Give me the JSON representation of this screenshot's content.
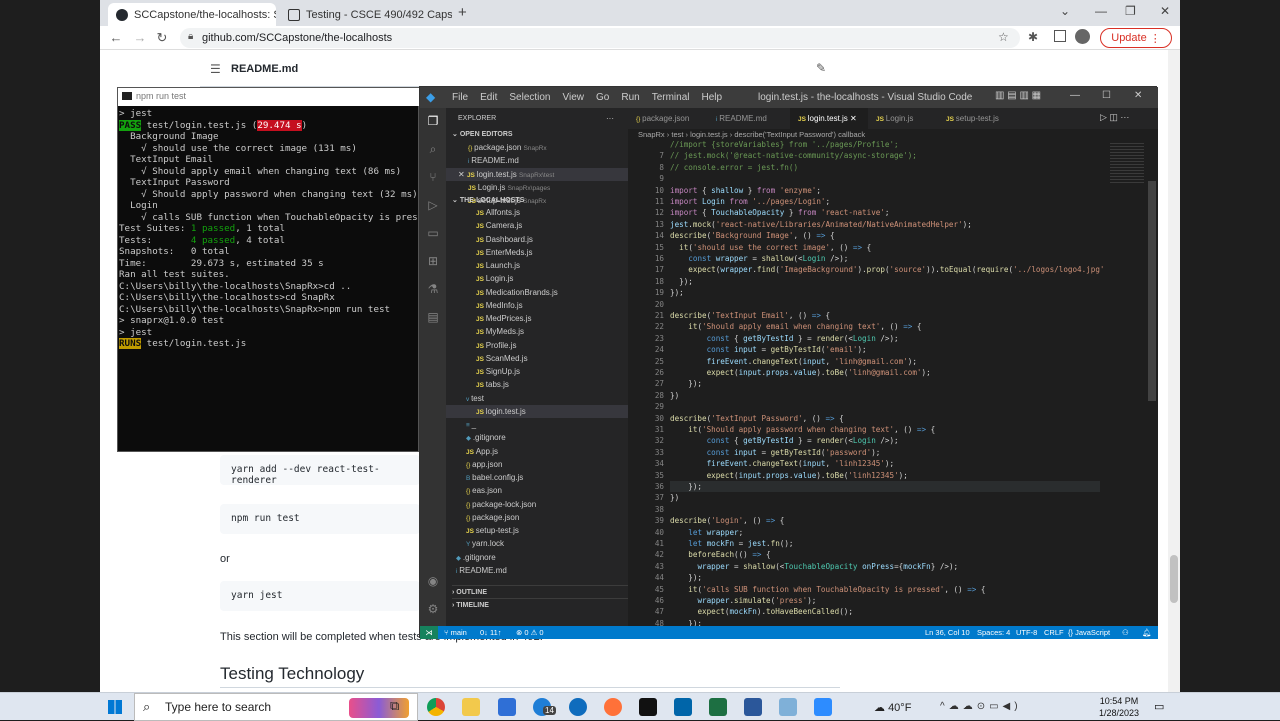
{
  "browser": {
    "tabs": [
      {
        "title": "SCCapstone/the-localhosts: Snap"
      },
      {
        "title": "Testing - CSCE 490/492 Capstone"
      }
    ],
    "url": "github.com/SCCapstone/the-localhosts",
    "update_label": "Update"
  },
  "github": {
    "file_title": "README.md",
    "code1": "yarn add --dev react-test-renderer",
    "code2": "npm run test",
    "or": "or",
    "code3": "yarn jest",
    "note": "This section will be completed when tests are implemented in 492.",
    "heading": "Testing Technology"
  },
  "terminal": {
    "title": "npm run test",
    "lines": [
      {
        "text": "> jest"
      },
      {
        "text": ""
      },
      {
        "pre": "",
        "badge": "PASS",
        "text": " test/login.test.js (",
        "hl": "29.474 s",
        "post": ")"
      },
      {
        "text": "  Background Image"
      },
      {
        "text": "    √ should use the correct image (131 ms)"
      },
      {
        "text": "  TextInput Email"
      },
      {
        "text": "    √ Should apply email when changing text (86 ms)"
      },
      {
        "text": "  TextInput Password"
      },
      {
        "text": "    √ Should apply password when changing text (32 ms)"
      },
      {
        "text": "  Login"
      },
      {
        "text": "    √ calls SUB function when TouchableOpacity is pressed"
      },
      {
        "text": ""
      },
      {
        "label": "Test Suites: ",
        "g": "1 passed",
        "text": ", 1 total"
      },
      {
        "label": "Tests:       ",
        "g": "4 passed",
        "text": ", 4 total"
      },
      {
        "text": "Snapshots:   0 total"
      },
      {
        "text": "Time:        29.673 s, estimated 35 s"
      },
      {
        "text": "Ran all test suites."
      },
      {
        "text": ""
      },
      {
        "text": "C:\\Users\\billy\\the-localhosts\\SnapRx>cd .."
      },
      {
        "text": ""
      },
      {
        "text": "C:\\Users\\billy\\the-localhosts>cd SnapRx"
      },
      {
        "text": ""
      },
      {
        "text": "C:\\Users\\billy\\the-localhosts\\SnapRx>npm run test"
      },
      {
        "text": ""
      },
      {
        "text": "> snaprx@1.0.0 test"
      },
      {
        "text": "> jest"
      },
      {
        "text": ""
      },
      {
        "text": ""
      },
      {
        "badge2": "RUNS",
        "text": " test/login.test.js"
      }
    ]
  },
  "vscode": {
    "title": "login.test.js - the-localhosts - Visual Studio Code",
    "menus": [
      "File",
      "Edit",
      "Selection",
      "View",
      "Go",
      "Run",
      "Terminal",
      "Help"
    ],
    "explorer_title": "EXPLORER",
    "open_editors_label": "OPEN EDITORS",
    "open_editors": [
      {
        "icon": "{}",
        "name": "package.json",
        "path": "SnapRx"
      },
      {
        "icon": "i",
        "name": "README.md",
        "path": ""
      },
      {
        "icon": "JS",
        "name": "login.test.js",
        "path": "SnapRx\\test",
        "active": true
      },
      {
        "icon": "JS",
        "name": "Login.js",
        "path": "SnapRx\\pages"
      },
      {
        "icon": "JS",
        "name": "setup-test.js",
        "path": "SnapRx"
      }
    ],
    "project_label": "THE-LOCALHOSTS",
    "files": [
      {
        "icon": "JS",
        "name": "Allfonts.js",
        "indent": 2
      },
      {
        "icon": "JS",
        "name": "Camera.js",
        "indent": 2
      },
      {
        "icon": "JS",
        "name": "Dashboard.js",
        "indent": 2
      },
      {
        "icon": "JS",
        "name": "EnterMeds.js",
        "indent": 2
      },
      {
        "icon": "JS",
        "name": "Launch.js",
        "indent": 2
      },
      {
        "icon": "JS",
        "name": "Login.js",
        "indent": 2
      },
      {
        "icon": "JS",
        "name": "MedicationBrands.js",
        "indent": 2
      },
      {
        "icon": "JS",
        "name": "MedInfo.js",
        "indent": 2
      },
      {
        "icon": "JS",
        "name": "MedPrices.js",
        "indent": 2
      },
      {
        "icon": "JS",
        "name": "MyMeds.js",
        "indent": 2
      },
      {
        "icon": "JS",
        "name": "Profile.js",
        "indent": 2
      },
      {
        "icon": "JS",
        "name": "ScanMed.js",
        "indent": 2
      },
      {
        "icon": "JS",
        "name": "SignUp.js",
        "indent": 2
      },
      {
        "icon": "JS",
        "name": "tabs.js",
        "indent": 2
      },
      {
        "icon": "v",
        "name": "test",
        "indent": 1
      },
      {
        "icon": "JS",
        "name": "login.test.js",
        "indent": 2,
        "active": true
      },
      {
        "icon": "≡",
        "name": "_",
        "indent": 1
      },
      {
        "icon": "◆",
        "name": ".gitignore",
        "indent": 1
      },
      {
        "icon": "JS",
        "name": "App.js",
        "indent": 1
      },
      {
        "icon": "{}",
        "name": "app.json",
        "indent": 1
      },
      {
        "icon": "B",
        "name": "babel.config.js",
        "indent": 1
      },
      {
        "icon": "{}",
        "name": "eas.json",
        "indent": 1
      },
      {
        "icon": "{}",
        "name": "package-lock.json",
        "indent": 1
      },
      {
        "icon": "{}",
        "name": "package.json",
        "indent": 1
      },
      {
        "icon": "JS",
        "name": "setup-test.js",
        "indent": 1
      },
      {
        "icon": "Y",
        "name": "yarn.lock",
        "indent": 1
      },
      {
        "icon": "◆",
        "name": ".gitignore",
        "indent": 0
      },
      {
        "icon": "i",
        "name": "README.md",
        "indent": 0
      }
    ],
    "outline_label": "OUTLINE",
    "timeline_label": "TIMELINE",
    "tabs": [
      {
        "icon": "{}",
        "name": "package.json"
      },
      {
        "icon": "i",
        "name": "README.md"
      },
      {
        "icon": "JS",
        "name": "login.test.js",
        "active": true
      },
      {
        "icon": "JS",
        "name": "Login.js"
      },
      {
        "icon": "JS",
        "name": "setup-test.js"
      }
    ],
    "breadcrumb": [
      "SnapRx",
      "test",
      "login.test.js",
      "describe('TextInput Password') callback"
    ],
    "code_lines": [
      {
        "n": "",
        "h": "<span class='c'>//import {storeVariables} from '../pages/Profile';</span>"
      },
      {
        "n": "7",
        "h": "<span class='c'>// jest.mock('@react-native-community/async-storage');</span>"
      },
      {
        "n": "8",
        "h": "<span class='c'>// console.error = jest.fn()</span>"
      },
      {
        "n": "9",
        "h": ""
      },
      {
        "n": "10",
        "h": "<span class='k'>import</span> { <span class='v'>shallow</span> } <span class='k'>from</span> <span class='s'>'enzyme'</span>;"
      },
      {
        "n": "11",
        "h": "<span class='k'>import</span> <span class='v'>Login</span> <span class='k'>from</span> <span class='s'>'../pages/Login'</span>;"
      },
      {
        "n": "12",
        "h": "<span class='k'>import</span> { <span class='v'>TouchableOpacity</span> } <span class='k'>from</span> <span class='s'>'react-native'</span>;"
      },
      {
        "n": "13",
        "h": "<span class='v'>jest</span>.<span class='f'>mock</span>(<span class='s'>'react-native/Libraries/Animated/NativeAnimatedHelper'</span>);"
      },
      {
        "n": "14",
        "h": "<span class='f'>describe</span>(<span class='s'>'Background Image'</span>, () <span class='b'>=&gt;</span> {"
      },
      {
        "n": "15",
        "h": "  <span class='f'>it</span>(<span class='s'>'should use the correct image'</span>, () <span class='b'>=&gt;</span> {"
      },
      {
        "n": "16",
        "h": "    <span class='b'>const</span> <span class='v'>wrapper</span> = <span class='f'>shallow</span>(&lt;<span class='t'>Login</span> /&gt;);"
      },
      {
        "n": "17",
        "h": "    <span class='f'>expect</span>(<span class='v'>wrapper</span>.<span class='f'>find</span>(<span class='s'>'ImageBackground'</span>).<span class='f'>prop</span>(<span class='s'>'source'</span>)).<span class='f'>toEqual</span>(<span class='f'>require</span>(<span class='s'>'../logos/logo4.jpg'</span>"
      },
      {
        "n": "18",
        "h": "  });"
      },
      {
        "n": "19",
        "h": "});"
      },
      {
        "n": "20",
        "h": ""
      },
      {
        "n": "21",
        "h": "<span class='f'>describe</span>(<span class='s'>'TextInput Email'</span>, () <span class='b'>=&gt;</span> {"
      },
      {
        "n": "22",
        "h": "    <span class='f'>it</span>(<span class='s'>'Should apply email when changing text'</span>, () <span class='b'>=&gt;</span> {"
      },
      {
        "n": "23",
        "h": "        <span class='b'>const</span> { <span class='v'>getByTestId</span> } = <span class='f'>render</span>(&lt;<span class='t'>Login</span> /&gt;);"
      },
      {
        "n": "24",
        "h": "        <span class='b'>const</span> <span class='v'>input</span> = <span class='f'>getByTestId</span>(<span class='s'>'email'</span>);"
      },
      {
        "n": "25",
        "h": "        <span class='v'>fireEvent</span>.<span class='f'>changeText</span>(<span class='v'>input</span>, <span class='s'>'linh@gmail.com'</span>);"
      },
      {
        "n": "26",
        "h": "        <span class='f'>expect</span>(<span class='v'>input</span>.<span class='v'>props</span>.<span class='v'>value</span>).<span class='f'>toBe</span>(<span class='s'>'linh@gmail.com'</span>);"
      },
      {
        "n": "27",
        "h": "    });"
      },
      {
        "n": "28",
        "h": "})"
      },
      {
        "n": "29",
        "h": ""
      },
      {
        "n": "30",
        "h": "<span class='f'>describe</span>(<span class='s'>'TextInput Password'</span>, () <span class='b'>=&gt;</span> {"
      },
      {
        "n": "31",
        "h": "    <span class='f'>it</span>(<span class='s'>'Should apply password when changing text'</span>, () <span class='b'>=&gt;</span> {"
      },
      {
        "n": "32",
        "h": "        <span class='b'>const</span> { <span class='v'>getByTestId</span> } = <span class='f'>render</span>(&lt;<span class='t'>Login</span> /&gt;);"
      },
      {
        "n": "33",
        "h": "        <span class='b'>const</span> <span class='v'>input</span> = <span class='f'>getByTestId</span>(<span class='s'>'password'</span>);"
      },
      {
        "n": "34",
        "h": "        <span class='v'>fireEvent</span>.<span class='f'>changeText</span>(<span class='v'>input</span>, <span class='s'>'linh12345'</span>);"
      },
      {
        "n": "35",
        "h": "        <span class='f'>expect</span>(<span class='v'>input</span>.<span class='v'>props</span>.<span class='v'>value</span>).<span class='f'>toBe</span>(<span class='s'>'linh12345'</span>);"
      },
      {
        "n": "36",
        "h": "    });"
      },
      {
        "n": "37",
        "h": "})"
      },
      {
        "n": "38",
        "h": ""
      },
      {
        "n": "39",
        "h": "<span class='f'>describe</span>(<span class='s'>'Login'</span>, () <span class='b'>=&gt;</span> {"
      },
      {
        "n": "40",
        "h": "    <span class='b'>let</span> <span class='v'>wrapper</span>;"
      },
      {
        "n": "41",
        "h": "    <span class='b'>let</span> <span class='v'>mockFn</span> = <span class='v'>jest</span>.<span class='f'>fn</span>();"
      },
      {
        "n": "42",
        "h": "    <span class='f'>beforeEach</span>(() <span class='b'>=&gt;</span> {"
      },
      {
        "n": "43",
        "h": "      <span class='v'>wrapper</span> = <span class='f'>shallow</span>(&lt;<span class='t'>TouchableOpacity</span> <span class='v'>onPress</span>={<span class='v'>mockFn</span>} /&gt;);"
      },
      {
        "n": "44",
        "h": "    });"
      },
      {
        "n": "45",
        "h": "    <span class='f'>it</span>(<span class='s'>'calls SUB function when TouchableOpacity is pressed'</span>, () <span class='b'>=&gt;</span> {"
      },
      {
        "n": "46",
        "h": "      <span class='v'>wrapper</span>.<span class='f'>simulate</span>(<span class='s'>'press'</span>);"
      },
      {
        "n": "47",
        "h": "      <span class='f'>expect</span>(<span class='v'>mockFn</span>).<span class='f'>toHaveBeenCalled</span>();"
      },
      {
        "n": "48",
        "h": "    });"
      }
    ],
    "status": {
      "branch": "main",
      "sync": "0↓ 11↑",
      "problems": "⊗ 0 ⚠ 0",
      "position": "Ln 36, Col 10",
      "spaces": "Spaces: 4",
      "encoding": "UTF-8",
      "eol": "CRLF",
      "language": "{} JavaScript"
    }
  },
  "taskbar": {
    "search_placeholder": "Type here to search",
    "badge": "14",
    "weather": "40°F",
    "time": "10:54 PM",
    "date": "1/28/2023"
  }
}
